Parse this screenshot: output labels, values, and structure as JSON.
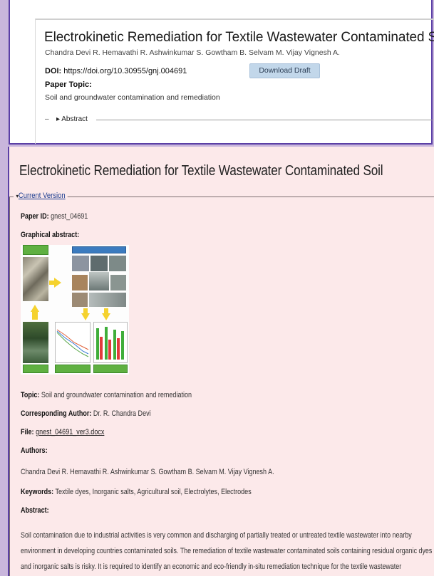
{
  "top": {
    "title": "Electrokinetic Remediation for Textile Wastewater Contaminated Soil",
    "authors": "Chandra Devi R. Hemavathi R. Ashwinkumar S. Gowtham B. Selvam M. Vijay Vignesh A.",
    "doi_label": "DOI:",
    "doi_value": "https://doi.org/10.30955/gnj.004691",
    "download_label": "Download Draft",
    "topic_label": "Paper Topic:",
    "topic_value": "Soil and groundwater contamination and remediation",
    "abstract_toggle_dash": "–",
    "abstract_toggle": "▸ Abstract"
  },
  "detail": {
    "title": "Electrokinetic Remediation for Textile Wastewater Contaminated Soil",
    "version_caret": "▾",
    "version_label": "Current Version",
    "paper_id_label": "Paper ID:",
    "paper_id_value": "gnest_04691",
    "graphical_abstract_label": "Graphical abstract:",
    "topic_label": "Topic:",
    "topic_value": "Soil and groundwater contamination and remediation",
    "corresponding_label": "Corresponding Author:",
    "corresponding_value": "Dr. R. Chandra Devi",
    "file_label": "File:",
    "file_value": "gnest_04691_ver3.docx",
    "authors_label": "Authors:",
    "authors_value": "Chandra Devi R. Hemavathi R. Ashwinkumar S. Gowtham B. Selvam M. Vijay Vignesh A.",
    "keywords_label": "Keywords:",
    "keywords_value": "Textile dyes, Inorganic salts, Agricultural soil, Electrolytes, Electrodes",
    "abstract_label": "Abstract:",
    "abstract_value": "Soil contamination due to industrial activities is very common and discharging of partially treated or untreated textile wastewater into nearby environment in developing countries contaminated soils. The remediation of textile wastewater contaminated soils containing residual organic dyes and inorganic salts is risky. It is required to identify an economic and eco-friendly in-situ remediation technique for the textile wastewater contaminated soil. This paper investigates the"
  },
  "colors": {
    "accent_border": "#5b3fa6",
    "page_bg": "#c9b6dc",
    "detail_bg": "#fce9ea",
    "button_bg": "#c2d7ea",
    "link": "#1a3b8f",
    "diagram_green": "#5fb041",
    "diagram_arrow": "#f5d22e"
  }
}
